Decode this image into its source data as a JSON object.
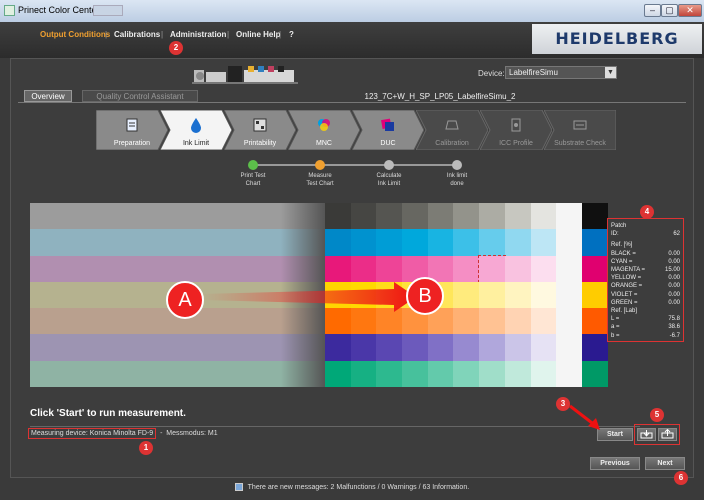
{
  "window": {
    "title": "Prinect Color Center [",
    "min": "–",
    "max": "▢",
    "close": "✕"
  },
  "menu": {
    "items": [
      "Output Conditions",
      "Calibrations",
      "Administration",
      "Online Help",
      "?"
    ],
    "brand": "HEIDELBERG"
  },
  "device": {
    "label": "Device:",
    "value": "LabelfireSimu"
  },
  "tabs": {
    "overview": "Overview",
    "qca": "Quality Control Assistant"
  },
  "job": {
    "name": "123_7C+W_H_SP_LP05_LabelfireSimu_2"
  },
  "wizard": {
    "steps": [
      {
        "label": "Preparation",
        "state": "done"
      },
      {
        "label": "Ink Limit",
        "state": "active"
      },
      {
        "label": "Printability",
        "state": "done"
      },
      {
        "label": "MNC",
        "state": "done"
      },
      {
        "label": "DUC",
        "state": "done"
      },
      {
        "label": "Calibration",
        "state": "disabled"
      },
      {
        "label": "ICC Profile",
        "state": "disabled"
      },
      {
        "label": "Substrate Check",
        "state": "disabled"
      }
    ]
  },
  "progress": {
    "steps": [
      {
        "label1": "Print Test",
        "label2": "Chart",
        "color": "#5cbf4a"
      },
      {
        "label1": "Measure",
        "label2": "Test Chart",
        "color": "#f0a030"
      },
      {
        "label1": "Calculate",
        "label2": "Ink Limit",
        "color": "#bbbbbb"
      },
      {
        "label1": "Ink limit",
        "label2": "done",
        "color": "#bbbbbb"
      }
    ]
  },
  "chart_rows": [
    {
      "name": "black",
      "left": "#9c9c9c",
      "colors": [
        "#3a3a38",
        "#464643",
        "#555551",
        "#676761",
        "#7c7c75",
        "#93938b",
        "#acaca4",
        "#c7c7c0",
        "#e4e4e0",
        "#f5f5f5",
        "#101010"
      ]
    },
    {
      "name": "cyan",
      "left": "#8fb2bf",
      "colors": [
        "#0088c8",
        "#0092cf",
        "#009dd6",
        "#00a8dc",
        "#18b4e2",
        "#3cc0e8",
        "#66ccec",
        "#90d8f0",
        "#bde6f5",
        "#f5f5f5",
        "#0070c0"
      ]
    },
    {
      "name": "magenta",
      "left": "#b18fb0",
      "colors": [
        "#e8187a",
        "#eb2d88",
        "#ee4497",
        "#f05ca6",
        "#f275b5",
        "#f58ec4",
        "#f7a8d3",
        "#f9c2e0",
        "#fcdeef",
        "#f5f5f5",
        "#e0006f"
      ]
    },
    {
      "name": "yellow",
      "left": "#b5b28f",
      "colors": [
        "#ffd500",
        "#ffd900",
        "#ffdd1a",
        "#ffe13a",
        "#ffe65a",
        "#ffeb7d",
        "#fff09f",
        "#fff4c0",
        "#fff9e0",
        "#f5f5f5",
        "#ffcc00"
      ]
    },
    {
      "name": "orange",
      "left": "#b9a08e",
      "colors": [
        "#ff6a00",
        "#ff7710",
        "#ff8426",
        "#ff923e",
        "#ffa158",
        "#ffb174",
        "#ffc293",
        "#ffd3b3",
        "#ffe6d4",
        "#f5f5f5",
        "#ff5a00"
      ]
    },
    {
      "name": "violet",
      "left": "#9d94b2",
      "colors": [
        "#3c2a9e",
        "#4a37a8",
        "#5a47b2",
        "#6c5abc",
        "#8070c6",
        "#978ad0",
        "#b0a7dc",
        "#cbc5e8",
        "#e6e2f4",
        "#f5f5f5",
        "#2a1a90"
      ]
    },
    {
      "name": "green",
      "left": "#8fb3a4",
      "colors": [
        "#00a878",
        "#16b083",
        "#2db98f",
        "#47c19c",
        "#63caab",
        "#80d4ba",
        "#a0dec9",
        "#c0e9db",
        "#e0f4ed",
        "#f5f5f5",
        "#009966"
      ]
    }
  ],
  "patch": {
    "title": "Patch",
    "id_label": "ID:",
    "id": "62",
    "ref_pct": "Ref. [%]",
    "inks": [
      {
        "name": "BLACK =",
        "value": "0.00"
      },
      {
        "name": "CYAN =",
        "value": "0.00"
      },
      {
        "name": "MAGENTA =",
        "value": "15.00"
      },
      {
        "name": "YELLOW =",
        "value": "0.00"
      },
      {
        "name": "ORANGE =",
        "value": "0.00"
      },
      {
        "name": "VIOLET =",
        "value": "0.00"
      },
      {
        "name": "GREEN =",
        "value": "0.00"
      }
    ],
    "ref_lab": "Ref. [Lab]",
    "lab": [
      {
        "name": "L =",
        "value": "75.8"
      },
      {
        "name": "a =",
        "value": "38.6"
      },
      {
        "name": "b =",
        "value": "-6.7"
      }
    ]
  },
  "annotations": {
    "a": "A",
    "b": "B",
    "n1": "1",
    "n2": "2",
    "n3": "3",
    "n4": "4",
    "n5": "5",
    "n6": "6"
  },
  "hint": "Click 'Start' to run measurement.",
  "measuring": {
    "device": "Measuring device: Konica Minolta FD-9",
    "sep": "-",
    "mode": "Messmodus: M1"
  },
  "buttons": {
    "start": "Start",
    "previous": "Previous",
    "next": "Next"
  },
  "status": "There are new messages: 2 Malfunctions / 0 Warnings / 63 Information."
}
